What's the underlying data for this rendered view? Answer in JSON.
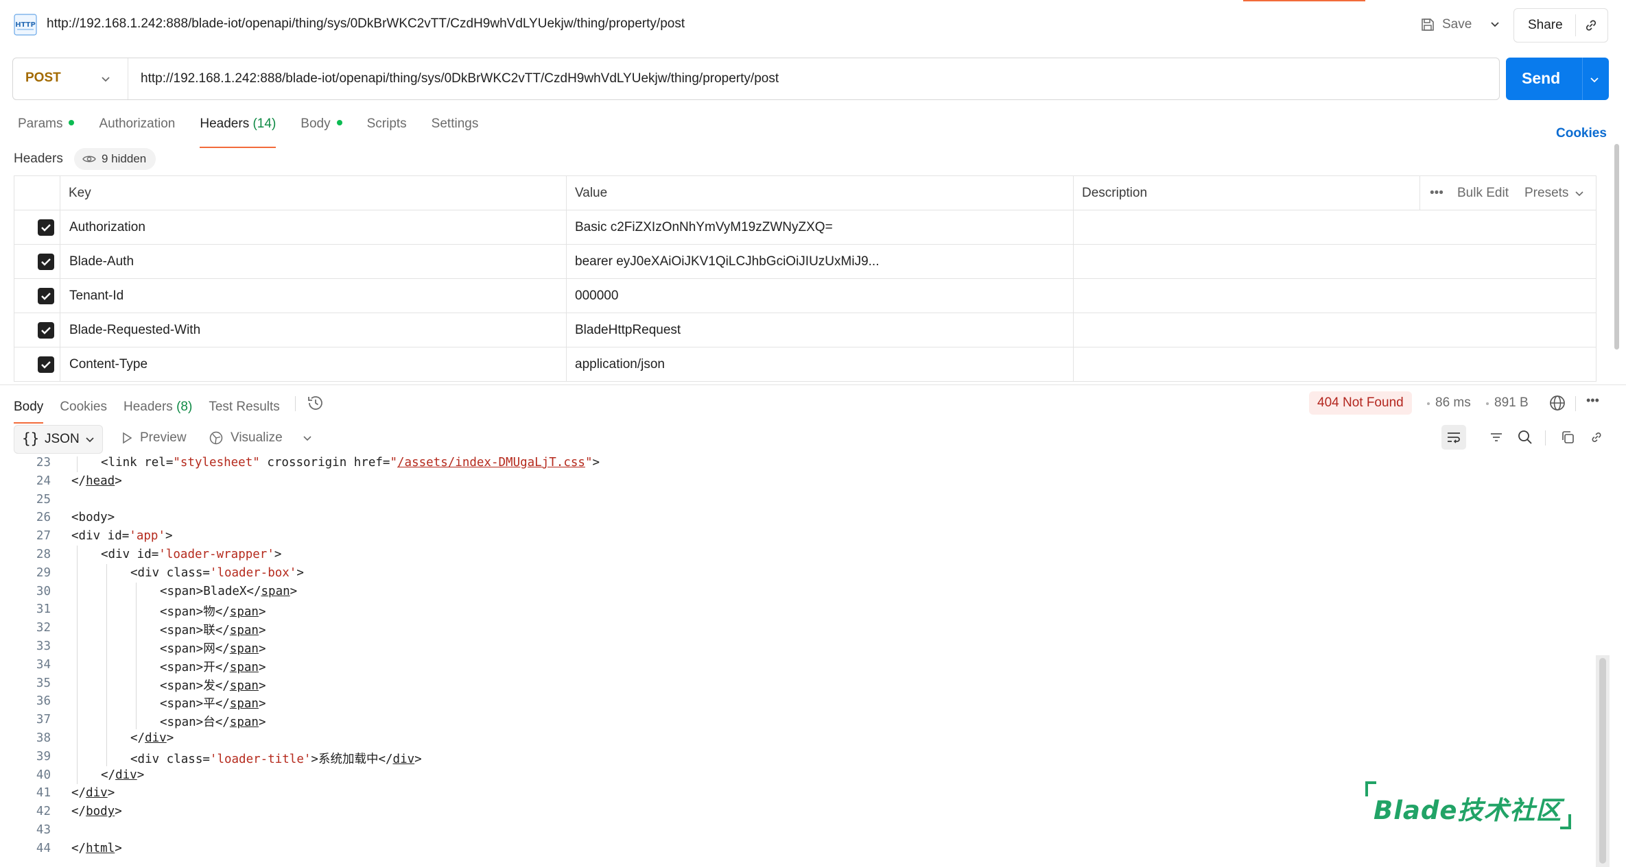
{
  "header": {
    "url_title": "http://192.168.1.242:888/blade-iot/openapi/thing/sys/0DkBrWKC2vTT/CzdH9whVdLYUekjw/thing/property/post",
    "save_label": "Save",
    "share_label": "Share"
  },
  "request": {
    "method": "POST",
    "url": "http://192.168.1.242:888/blade-iot/openapi/thing/sys/0DkBrWKC2vTT/CzdH9whVdLYUekjw/thing/property/post",
    "send_label": "Send",
    "cookies_label": "Cookies",
    "tabs": [
      {
        "label": "Params",
        "count": "",
        "dot": true
      },
      {
        "label": "Authorization",
        "count": "",
        "dot": false
      },
      {
        "label": "Headers",
        "count": "(14)",
        "dot": false,
        "active": true
      },
      {
        "label": "Body",
        "count": "",
        "dot": true
      },
      {
        "label": "Scripts",
        "count": "",
        "dot": false
      },
      {
        "label": "Settings",
        "count": "",
        "dot": false
      }
    ]
  },
  "headers_section": {
    "label": "Headers",
    "hidden": "9 hidden",
    "columns": {
      "key": "Key",
      "value": "Value",
      "description": "Description"
    },
    "bulk_edit": "Bulk Edit",
    "presets": "Presets",
    "rows": [
      {
        "key": "Authorization",
        "value": "Basic c2FiZXIzOnNhYmVyM19zZWNyZXQ=",
        "checked": true
      },
      {
        "key": "Blade-Auth",
        "value": "bearer eyJ0eXAiOiJKV1QiLCJhbGciOiJIUzUxMiJ9...",
        "checked": true
      },
      {
        "key": "Tenant-Id",
        "value": "000000",
        "checked": true
      },
      {
        "key": "Blade-Requested-With",
        "value": "BladeHttpRequest",
        "checked": true
      },
      {
        "key": "Content-Type",
        "value": "application/json",
        "checked": true
      }
    ]
  },
  "response": {
    "tabs": [
      {
        "label": "Body",
        "count": "",
        "active": true
      },
      {
        "label": "Cookies",
        "count": ""
      },
      {
        "label": "Headers",
        "count": "(8)"
      },
      {
        "label": "Test Results",
        "count": ""
      }
    ],
    "status": "404 Not Found",
    "time": "86 ms",
    "size": "891 B",
    "format": "JSON",
    "preview_label": "Preview",
    "visualize_label": "Visualize"
  },
  "code_lines": [
    {
      "n": "23",
      "indent": 1,
      "html": "<link rel=\"stylesheet\" crossorigin href=\"<a>/assets/index-DMUgaLjT.css</a>\">"
    },
    {
      "n": "24",
      "indent": 0,
      "text": "</head>"
    },
    {
      "n": "25",
      "indent": 0,
      "text": ""
    },
    {
      "n": "26",
      "indent": 0,
      "text": "<body>"
    },
    {
      "n": "27",
      "indent": 0,
      "text": "<div id='app'>"
    },
    {
      "n": "28",
      "indent": 1,
      "text": "<div id='loader-wrapper'>"
    },
    {
      "n": "29",
      "indent": 2,
      "text": "<div class='loader-box'>"
    },
    {
      "n": "30",
      "indent": 3,
      "text": "<span>BladeX</span>"
    },
    {
      "n": "31",
      "indent": 3,
      "text": "<span>物</span>"
    },
    {
      "n": "32",
      "indent": 3,
      "text": "<span>联</span>"
    },
    {
      "n": "33",
      "indent": 3,
      "text": "<span>网</span>"
    },
    {
      "n": "34",
      "indent": 3,
      "text": "<span>开</span>"
    },
    {
      "n": "35",
      "indent": 3,
      "text": "<span>发</span>"
    },
    {
      "n": "36",
      "indent": 3,
      "text": "<span>平</span>"
    },
    {
      "n": "37",
      "indent": 3,
      "text": "<span>台</span>"
    },
    {
      "n": "38",
      "indent": 2,
      "text": "</div>"
    },
    {
      "n": "39",
      "indent": 2,
      "text": "<div class='loader-title'>系统加载中</div>"
    },
    {
      "n": "40",
      "indent": 1,
      "text": "</div>"
    },
    {
      "n": "41",
      "indent": 0,
      "text": "</div>"
    },
    {
      "n": "42",
      "indent": 0,
      "text": "</body>"
    },
    {
      "n": "43",
      "indent": 0,
      "text": ""
    },
    {
      "n": "44",
      "indent": 0,
      "text": "</html>"
    }
  ],
  "watermark": "Blade技术社区",
  "colors": {
    "accent": "#f26b3a",
    "send": "#097bed",
    "method": "#a36a00",
    "status_error": "#b3261e",
    "string": "#b52a1d"
  }
}
